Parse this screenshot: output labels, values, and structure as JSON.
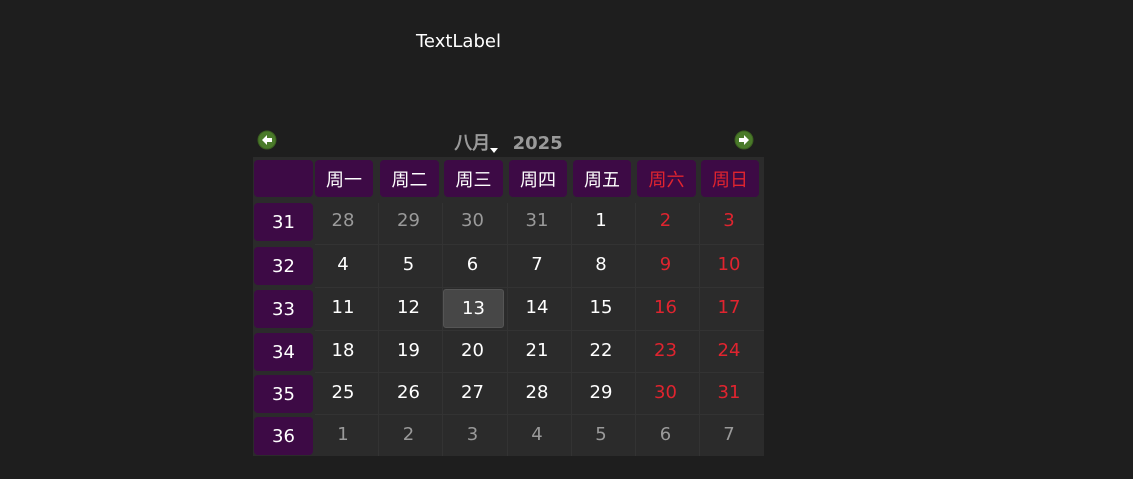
{
  "window": {
    "text_label": "TextLabel"
  },
  "calendar": {
    "month": "八月",
    "year": "2025",
    "weekday_headers": [
      "周一",
      "周二",
      "周三",
      "周四",
      "周五",
      "周六",
      "周日"
    ],
    "weeks": [
      {
        "week": "31",
        "days": [
          {
            "d": "28",
            "other": true
          },
          {
            "d": "29",
            "other": true
          },
          {
            "d": "30",
            "other": true
          },
          {
            "d": "31",
            "other": true
          },
          {
            "d": "1"
          },
          {
            "d": "2"
          },
          {
            "d": "3"
          }
        ]
      },
      {
        "week": "32",
        "days": [
          {
            "d": "4"
          },
          {
            "d": "5"
          },
          {
            "d": "6"
          },
          {
            "d": "7"
          },
          {
            "d": "8"
          },
          {
            "d": "9"
          },
          {
            "d": "10"
          }
        ]
      },
      {
        "week": "33",
        "days": [
          {
            "d": "11"
          },
          {
            "d": "12"
          },
          {
            "d": "13",
            "selected": true
          },
          {
            "d": "14"
          },
          {
            "d": "15"
          },
          {
            "d": "16"
          },
          {
            "d": "17"
          }
        ]
      },
      {
        "week": "34",
        "days": [
          {
            "d": "18"
          },
          {
            "d": "19"
          },
          {
            "d": "20"
          },
          {
            "d": "21"
          },
          {
            "d": "22"
          },
          {
            "d": "23"
          },
          {
            "d": "24"
          }
        ]
      },
      {
        "week": "35",
        "days": [
          {
            "d": "25"
          },
          {
            "d": "26"
          },
          {
            "d": "27"
          },
          {
            "d": "28"
          },
          {
            "d": "29"
          },
          {
            "d": "30"
          },
          {
            "d": "31"
          }
        ]
      },
      {
        "week": "36",
        "days": [
          {
            "d": "1",
            "other": true
          },
          {
            "d": "2",
            "other": true
          },
          {
            "d": "3",
            "other": true
          },
          {
            "d": "4",
            "other": true
          },
          {
            "d": "5",
            "other": true
          },
          {
            "d": "6",
            "other": true
          },
          {
            "d": "7",
            "other": true
          }
        ]
      }
    ],
    "colors": {
      "header_bg": "#3d0a45",
      "weekend_text": "#e0242f",
      "other_month_text": "#9a9a9a",
      "nav_icon": "#4a7a2a"
    },
    "icons": {
      "prev": "arrow-left-circle-icon",
      "next": "arrow-right-circle-icon"
    }
  }
}
